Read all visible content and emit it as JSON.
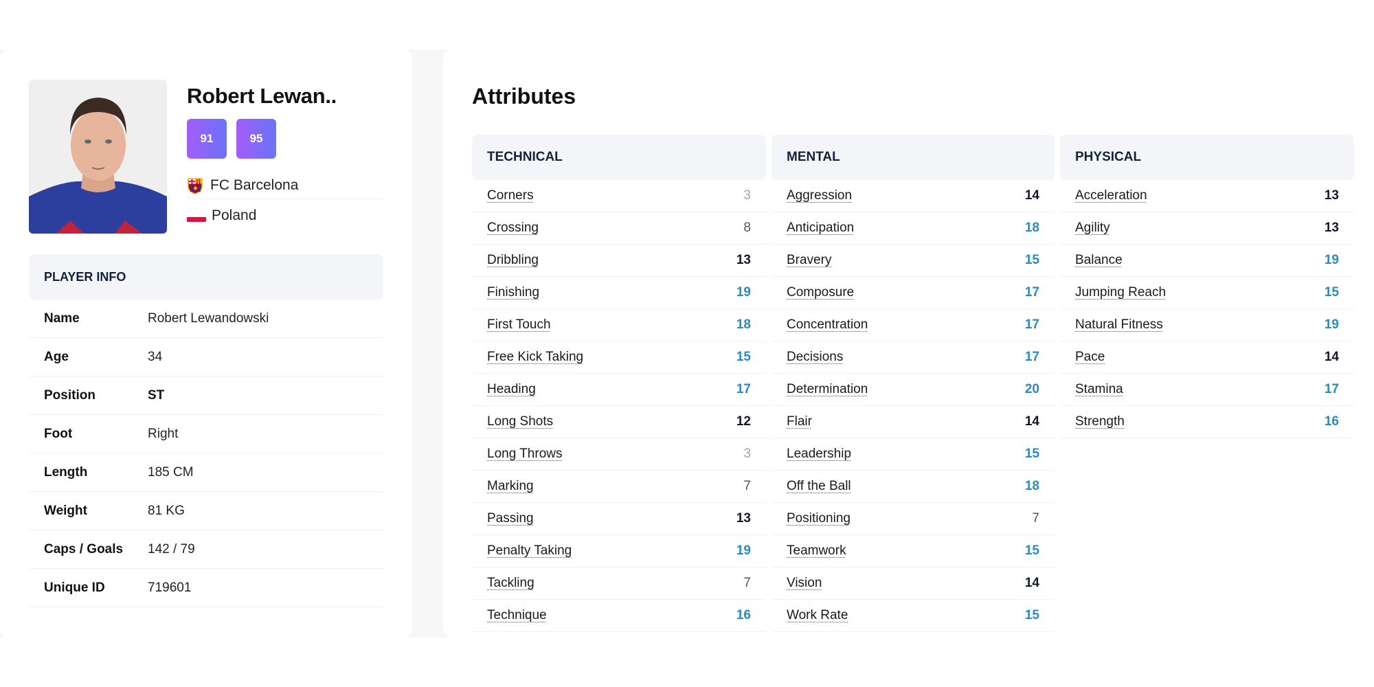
{
  "profile": {
    "display_name": "Robert Lewan..",
    "ratings": [
      {
        "label": "current_ability",
        "value": "91"
      },
      {
        "label": "potential_ability",
        "value": "95"
      }
    ],
    "club": "FC Barcelona",
    "club_icon": "club-crest-icon",
    "country": "Poland",
    "country_icon": "poland-flag-icon",
    "badge_gradient": [
      "#a35df7",
      "#6a73f9"
    ]
  },
  "player_info": {
    "title": "PLAYER INFO",
    "rows": [
      {
        "label": "Name",
        "value": "Robert Lewandowski"
      },
      {
        "label": "Age",
        "value": "34"
      },
      {
        "label": "Position",
        "value": "ST"
      },
      {
        "label": "Foot",
        "value": "Right"
      },
      {
        "label": "Length",
        "value": "185 CM"
      },
      {
        "label": "Weight",
        "value": "81 KG"
      },
      {
        "label": "Caps / Goals",
        "value": "142 / 79"
      },
      {
        "label": "Unique ID",
        "value": "719601"
      }
    ]
  },
  "attributes": {
    "title": "Attributes",
    "value_colors": {
      "low": "#a5a5a5",
      "mid": "#555555",
      "good": "#111827",
      "high": "#2b8ac1"
    },
    "columns": [
      {
        "title": "TECHNICAL",
        "items": [
          {
            "name": "Corners",
            "value": 3
          },
          {
            "name": "Crossing",
            "value": 8
          },
          {
            "name": "Dribbling",
            "value": 13
          },
          {
            "name": "Finishing",
            "value": 19
          },
          {
            "name": "First Touch",
            "value": 18
          },
          {
            "name": "Free Kick Taking",
            "value": 15
          },
          {
            "name": "Heading",
            "value": 17
          },
          {
            "name": "Long Shots",
            "value": 12
          },
          {
            "name": "Long Throws",
            "value": 3
          },
          {
            "name": "Marking",
            "value": 7
          },
          {
            "name": "Passing",
            "value": 13
          },
          {
            "name": "Penalty Taking",
            "value": 19
          },
          {
            "name": "Tackling",
            "value": 7
          },
          {
            "name": "Technique",
            "value": 16
          }
        ]
      },
      {
        "title": "MENTAL",
        "items": [
          {
            "name": "Aggression",
            "value": 14
          },
          {
            "name": "Anticipation",
            "value": 18
          },
          {
            "name": "Bravery",
            "value": 15
          },
          {
            "name": "Composure",
            "value": 17
          },
          {
            "name": "Concentration",
            "value": 17
          },
          {
            "name": "Decisions",
            "value": 17
          },
          {
            "name": "Determination",
            "value": 20
          },
          {
            "name": "Flair",
            "value": 14
          },
          {
            "name": "Leadership",
            "value": 15
          },
          {
            "name": "Off the Ball",
            "value": 18
          },
          {
            "name": "Positioning",
            "value": 7
          },
          {
            "name": "Teamwork",
            "value": 15
          },
          {
            "name": "Vision",
            "value": 14
          },
          {
            "name": "Work Rate",
            "value": 15
          }
        ]
      },
      {
        "title": "PHYSICAL",
        "items": [
          {
            "name": "Acceleration",
            "value": 13
          },
          {
            "name": "Agility",
            "value": 13
          },
          {
            "name": "Balance",
            "value": 19
          },
          {
            "name": "Jumping Reach",
            "value": 15
          },
          {
            "name": "Natural Fitness",
            "value": 19
          },
          {
            "name": "Pace",
            "value": 14
          },
          {
            "name": "Stamina",
            "value": 17
          },
          {
            "name": "Strength",
            "value": 16
          }
        ]
      }
    ]
  }
}
